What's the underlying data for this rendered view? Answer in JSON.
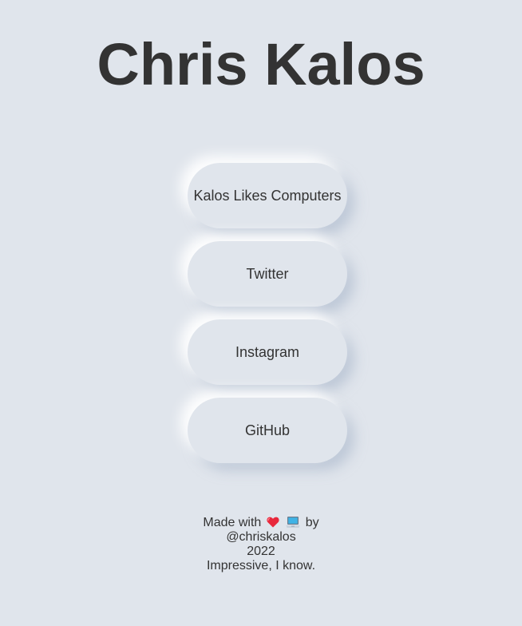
{
  "header": {
    "title": "Chris Kalos"
  },
  "links": [
    {
      "label": "Kalos Likes Computers"
    },
    {
      "label": "Twitter"
    },
    {
      "label": "Instagram"
    },
    {
      "label": "GitHub"
    }
  ],
  "footer": {
    "made_with": "Made with",
    "by": "by",
    "handle": "@chriskalos",
    "year": "2022",
    "tagline": "Impressive, I know.",
    "heart_icon": "heart-icon",
    "laptop_icon": "laptop-icon"
  },
  "colors": {
    "background": "#e0e5ec",
    "text": "#333333",
    "heart": "#e8283c",
    "laptop_screen": "#3fb3e6"
  }
}
